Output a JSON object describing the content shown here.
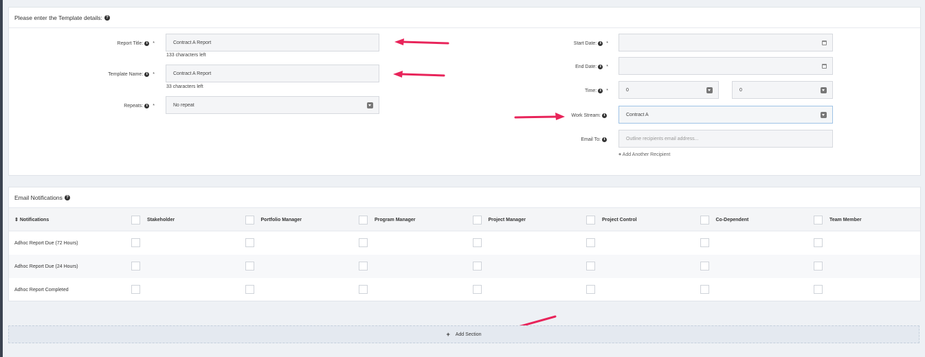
{
  "template_details": {
    "title": "Please enter the Template details:",
    "report_title": {
      "label": "Report Title:",
      "value": "Contract A Report",
      "hint": "133 characters left"
    },
    "template_name": {
      "label": "Template Name:",
      "value": "Contract A Report",
      "hint": "33 characters left"
    },
    "repeats": {
      "label": "Repeats:",
      "value": "No repeat"
    },
    "start_date": {
      "label": "Start Date:",
      "value": ""
    },
    "end_date": {
      "label": "End Date:",
      "value": ""
    },
    "time": {
      "label": "Time:",
      "hours": "0",
      "minutes": "0"
    },
    "work_stream": {
      "label": "Work Stream:",
      "value": "Contract A"
    },
    "email_to": {
      "label": "Email To:",
      "placeholder": "Outline recipients email address...",
      "add_label": "Add Another Recipient"
    },
    "required_mark": "*"
  },
  "email_notifications": {
    "title": "Email Notifications",
    "column_header": "Notifications",
    "roles": [
      "Stakeholder",
      "Portfolio Manager",
      "Program Manager",
      "Project Manager",
      "Project Control",
      "Co-Dependent",
      "Team Member"
    ],
    "rows": [
      "Adhoc Report Due (72 Hours)",
      "Adhoc Report Due (24 Hours)",
      "Adhoc Report Completed"
    ]
  },
  "add_section_label": "Add Section",
  "colors": {
    "arrow": "#e8245a",
    "page_bg": "#eef1f5",
    "focus_border": "#9fc3e6"
  },
  "icons": [
    "question-circle-icon",
    "info-icon",
    "calendar-icon",
    "caret-down-icon",
    "plus-icon",
    "sort-icon",
    "arrow-annotation"
  ]
}
